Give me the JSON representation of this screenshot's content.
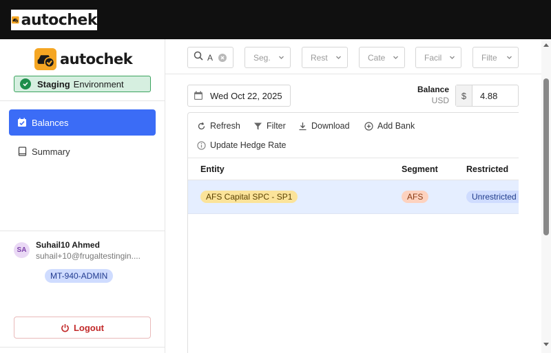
{
  "brand": {
    "name": "autochek",
    "primary_color": "#f5a623",
    "dark_color": "#1a1a1a"
  },
  "environment": {
    "label_strong": "Staging",
    "label": "Environment",
    "color": "#1e8e4a"
  },
  "sidebar": {
    "items": [
      {
        "label": "Balances",
        "icon": "calendar-check-icon",
        "active": true
      },
      {
        "label": "Summary",
        "icon": "book-icon",
        "active": false
      }
    ],
    "accent_color": "#3b6cf6"
  },
  "user": {
    "initials": "SA",
    "name": "Suhail10 Ahmed",
    "email": "suhail+10@frugaltestingin....",
    "role": "MT-940-ADMIN"
  },
  "logout": {
    "label": "Logout",
    "icon": "power-icon",
    "color": "#c22929"
  },
  "filters": {
    "search_value": "A",
    "dropdowns": [
      "Seg.",
      "Rest",
      "Cate",
      "Facil",
      "Filte"
    ]
  },
  "date": {
    "value": "Wed Oct 22, 2025",
    "icon": "calendar-icon"
  },
  "balance": {
    "label": "Balance",
    "currency": "USD",
    "prefix": "$",
    "value": "4.88"
  },
  "toolbar": {
    "refresh": "Refresh",
    "filter": "Filter",
    "download": "Download",
    "add_bank": "Add Bank",
    "update_hedge": "Update Hedge Rate"
  },
  "table": {
    "columns": [
      "Entity",
      "Segment",
      "Restricted"
    ],
    "rows": [
      {
        "entity": "AFS Capital SPC - SP1",
        "segment": "AFS",
        "restricted": "Unrestricted"
      }
    ]
  }
}
